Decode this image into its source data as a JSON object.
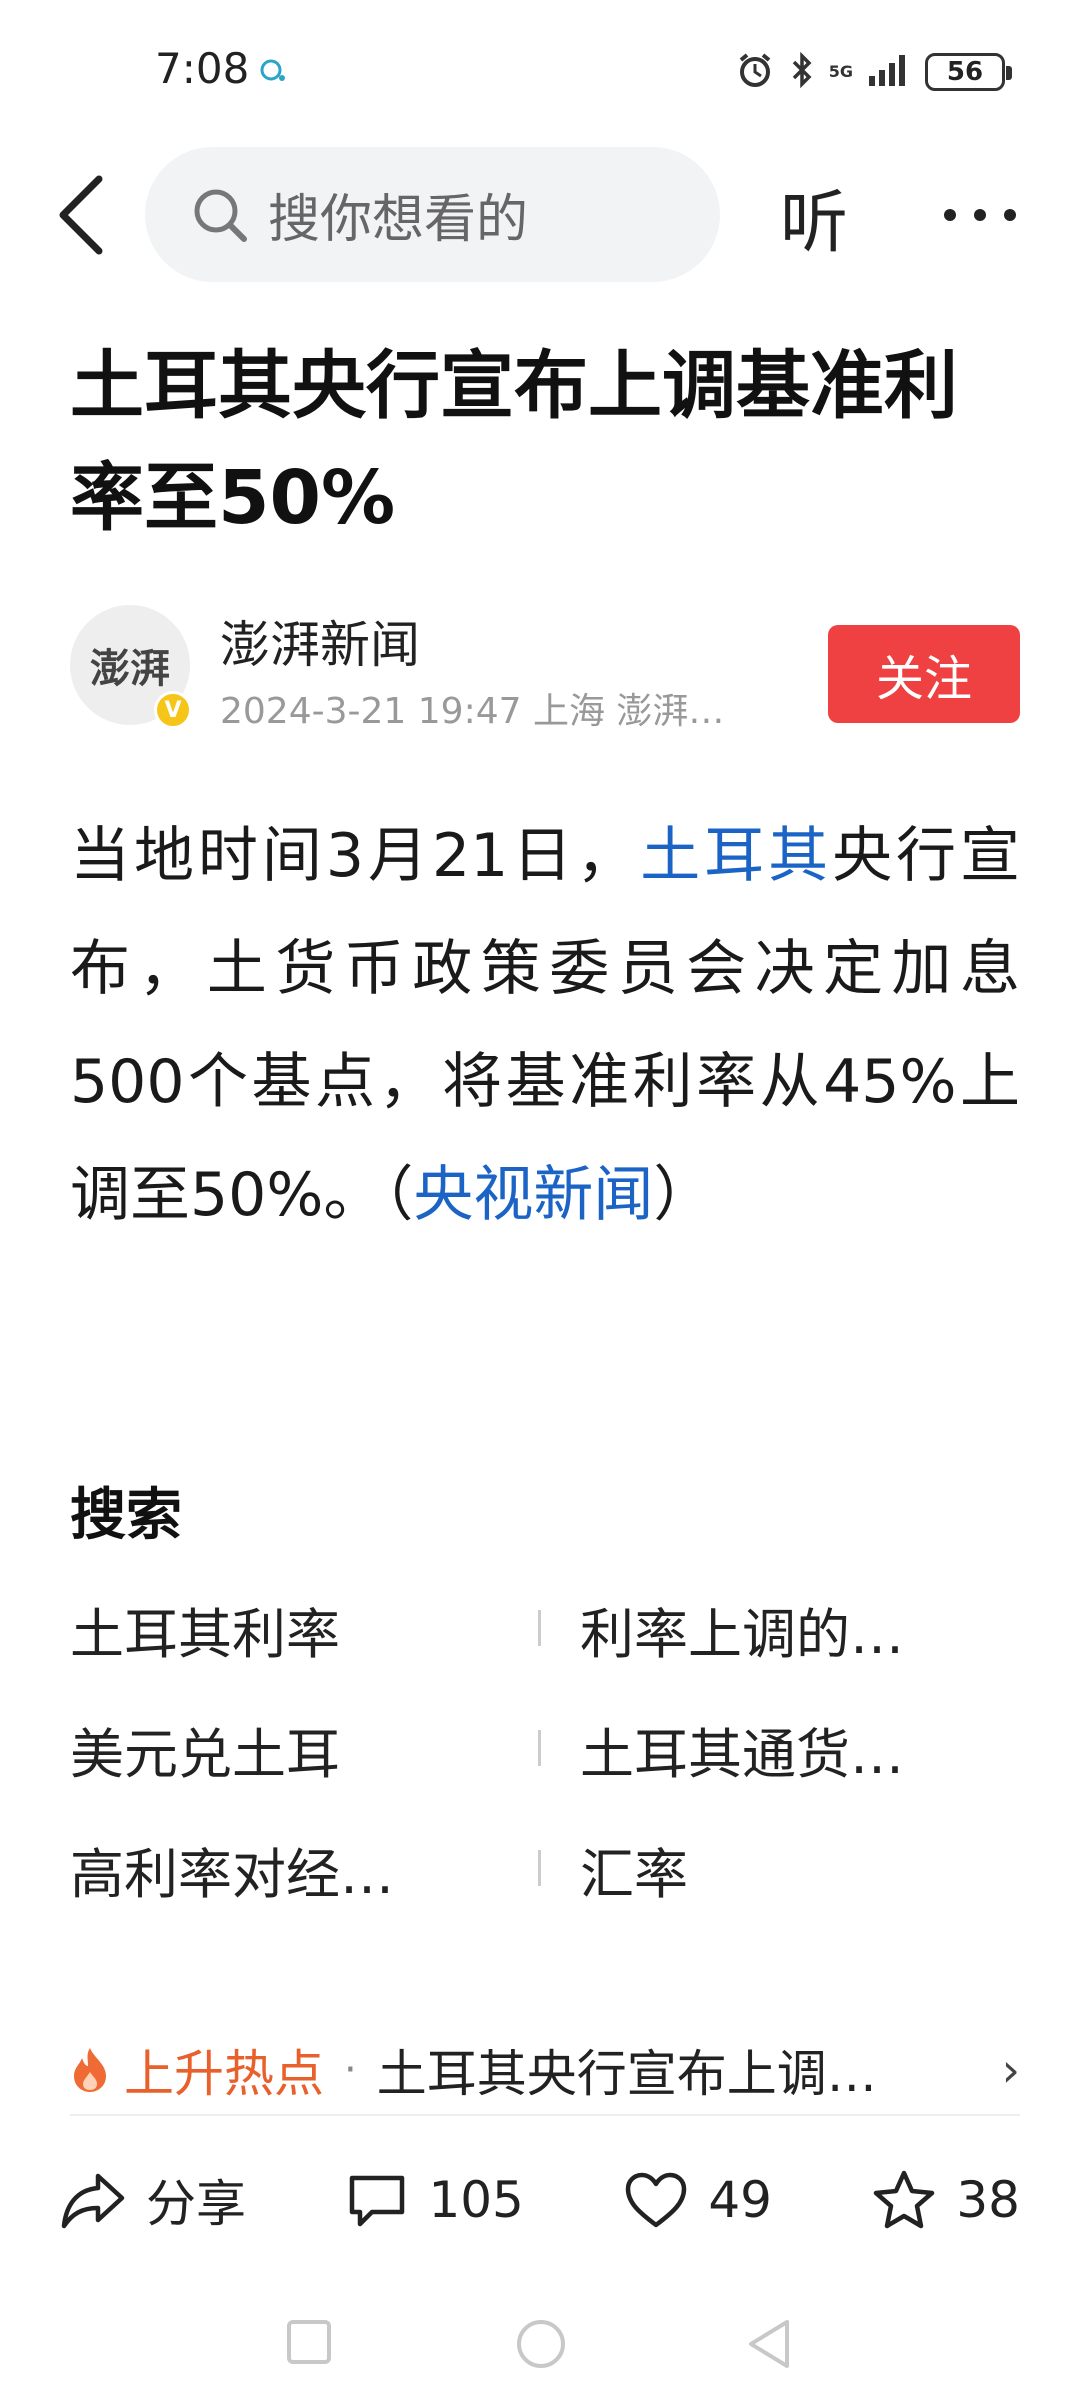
{
  "status_bar": {
    "time": "7:08",
    "network": "5G",
    "battery": "56"
  },
  "top_bar": {
    "search_placeholder": "搜你想看的",
    "listen_label": "听"
  },
  "article": {
    "title": "土耳其央行宣布上调基准利率至50%",
    "author": {
      "name": "澎湃新闻",
      "avatar_text": "澎湃",
      "verified": "V"
    },
    "meta": "2024-3-21  19:47  上海  澎湃…",
    "follow_label": "关注",
    "body": {
      "p1": "当地时间3月21日，",
      "link1": "土耳其",
      "p2": "央行宣布，土货币政策委员会决定加息500个基点，将基准利率从45%上调至50%。（",
      "link2": "央视新闻",
      "p3": "）"
    }
  },
  "search_section": {
    "title": "搜索",
    "items": [
      {
        "left": "土耳其利率",
        "right": "利率上调的…"
      },
      {
        "left": "美元兑土耳",
        "right": "土耳其通货…"
      },
      {
        "left": "高利率对经…",
        "right": "汇率"
      }
    ]
  },
  "hot_bar": {
    "label": "上升热点",
    "dot": "·",
    "text": "土耳其央行宣布上调…",
    "arrow": "›"
  },
  "actions": {
    "share": "分享",
    "comments": "105",
    "likes": "49",
    "favorites": "38"
  },
  "colors": {
    "accent_red": "#f04142",
    "link_blue": "#1b64c5",
    "hot_orange": "#e8602c"
  },
  "icons": [
    "back-icon",
    "search-icon",
    "more-icon",
    "fire-icon",
    "share-icon",
    "comment-icon",
    "heart-icon",
    "star-icon",
    "nav-square-icon",
    "nav-circle-icon",
    "nav-back-icon"
  ]
}
